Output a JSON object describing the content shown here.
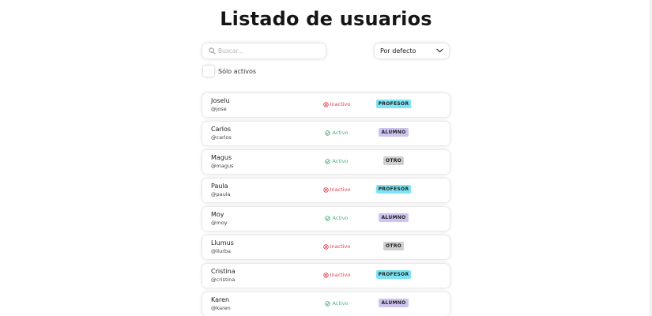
{
  "page": {
    "title": "Listado de usuarios"
  },
  "search": {
    "placeholder": "Buscar...",
    "value": "",
    "icon": "search-icon"
  },
  "sort": {
    "selected": "Por defecto",
    "icon": "chevron-down-icon"
  },
  "filter": {
    "label": "Sólo activos",
    "checked": false
  },
  "colors": {
    "active": "#4caf7a",
    "inactive": "#e0404a",
    "profesor": "#7ee3f2",
    "alumno": "#cfc3ef",
    "otro": "#cfcfcf"
  },
  "users": [
    {
      "name": "Joselu",
      "handle": "@jose",
      "status": "Inactivo",
      "active": false,
      "role": "PROFESOR"
    },
    {
      "name": "Carlos",
      "handle": "@carlos",
      "status": "Activo",
      "active": true,
      "role": "ALUMNO"
    },
    {
      "name": "Magus",
      "handle": "@magus",
      "status": "Activo",
      "active": true,
      "role": "OTRO"
    },
    {
      "name": "Paula",
      "handle": "@paula",
      "status": "Inactivo",
      "active": false,
      "role": "PROFESOR"
    },
    {
      "name": "Moy",
      "handle": "@moy",
      "status": "Activo",
      "active": true,
      "role": "ALUMNO"
    },
    {
      "name": "Llumus",
      "handle": "@llurba",
      "status": "Inactivo",
      "active": false,
      "role": "OTRO"
    },
    {
      "name": "Cristina",
      "handle": "@cristina",
      "status": "Inactivo",
      "active": false,
      "role": "PROFESOR"
    },
    {
      "name": "Karen",
      "handle": "@karen",
      "status": "Activo",
      "active": true,
      "role": "ALUMNO"
    }
  ]
}
